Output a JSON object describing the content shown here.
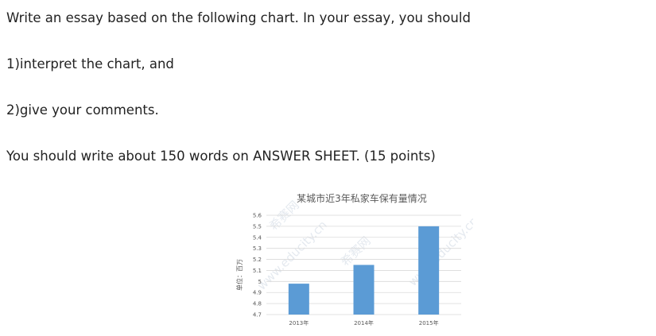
{
  "prompt": {
    "line1": "Write an essay based on the following chart. In your essay, you should",
    "line2": "1)interpret the chart, and",
    "line3": "2)give your comments.",
    "line4": "You should write about 150 words on ANSWER SHEET. (15 points)"
  },
  "chart_data": {
    "type": "bar",
    "title": "某城市近3年私家车保有量情况",
    "ylabel": "单位：百万",
    "xlabel": "",
    "categories": [
      "2013年",
      "2014年",
      "2015年"
    ],
    "values": [
      4.98,
      5.15,
      5.5
    ],
    "ylim": [
      4.7,
      5.6
    ],
    "yticks": [
      "5.6",
      "5.5",
      "5.4",
      "5.3",
      "5.2",
      "5.1",
      "5",
      "4.9",
      "4.8",
      "4.7"
    ],
    "grid": true,
    "bar_color": "#5b9bd5"
  },
  "watermark": {
    "text1": "www.educity.cn",
    "text2": "希赛网"
  }
}
